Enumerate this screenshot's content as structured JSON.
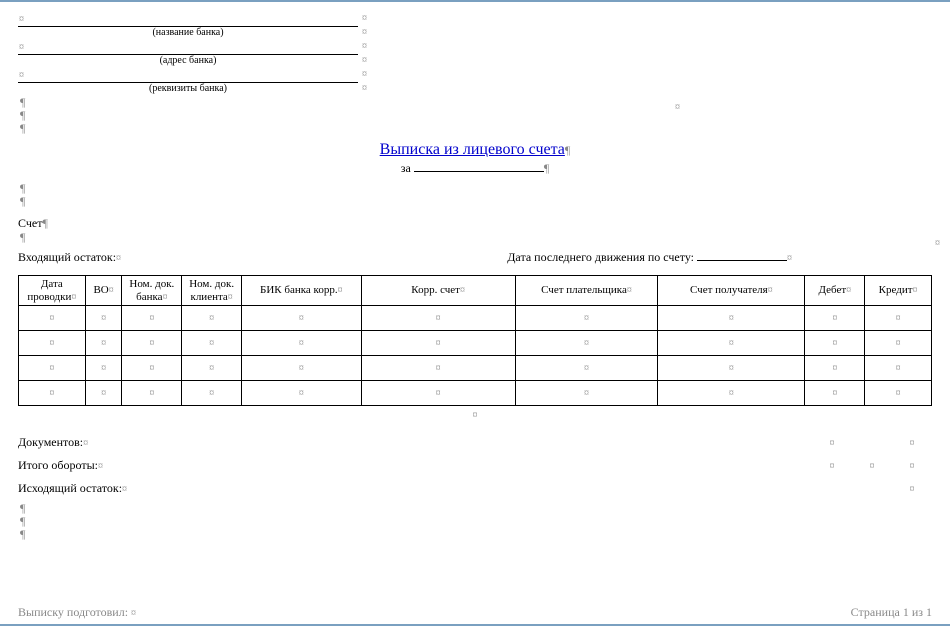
{
  "header": {
    "bank_name_caption": "(название банка)",
    "bank_address_caption": "(адрес банка)",
    "bank_req_caption": "(реквизиты банка)"
  },
  "title": "Выписка из лицевого счета",
  "za_label": "за",
  "account_label": "Счет",
  "incoming_balance_label": "Входящий остаток:",
  "last_movement_label": "Дата последнего движения по счету:",
  "table_headers": {
    "date": "Дата проводки",
    "vo": "ВО",
    "nom_bank": "Ном. док. банка",
    "nom_client": "Ном. док. клиента",
    "bik": "БИК банка корр.",
    "korr": "Корр. счет",
    "payer": "Счет плательщика",
    "payee": "Счет получателя",
    "debit": "Дебет",
    "credit": "Кредит"
  },
  "summary": {
    "documents_label": "Документов:",
    "turnover_label": "Итого обороты:",
    "outgoing_label": "Исходящий остаток:"
  },
  "footer": {
    "prepared_label": "Выписку подготовил:",
    "page": "Страница 1 из 1"
  },
  "marks": {
    "cell": "¤",
    "para": "¶"
  }
}
